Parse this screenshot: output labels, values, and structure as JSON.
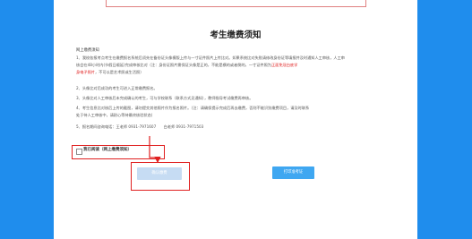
{
  "title": "考生缴费须知",
  "notice": {
    "heading": "网上缴费须知",
    "paragraphs": {
      "p1a": "1、我校各报考点考生在缴费报名系统后须先在备份证头像模版上传与一寸证件照片上传比对。如果系统比对失败请修改身份证等填报并及时通知人工审核，人工审",
      "p1b": "核会在48小时内(节假日顺延)完成审核比对（注：身份证照片需保证头像是正的，不能是横的或者倒的，一寸证件照为",
      "p1b_red": "正面免冠白底学",
      "p1c_red": "身电子照片",
      "p1c": "，不可以是艺术照或生活照）",
      "p2": "2、头像比对后成功的考生可进入正常缴费报名。",
      "p3": "3、头像比对人工审核后未完成确认的考生，可与学校联系（联系方式见通知），教师指导考试缴费再审核。",
      "p4a": "4、考生信息比对核后上传的截图，请勿提交其他照片作为报名照片。（注：请确保提示完成后再去缴费，否则不能识别缴费项目，请及时联系",
      "p4b": "处于待人工审核中，请耐心等待最终核验状态）",
      "p5": "5、报名期间咨询电话：王老师 0931-7971607　　白老师 0931-7971503"
    }
  },
  "confirm": {
    "label": "我已阅读（网上缴费须知）",
    "checked": false
  },
  "buttons": {
    "pay": "确认缴费",
    "print": "打印准考证"
  },
  "colors": {
    "background": "#1f8ded",
    "annotation": "#e02020",
    "print_button": "#3fa7f1",
    "pay_button": "#c6dcf3"
  }
}
